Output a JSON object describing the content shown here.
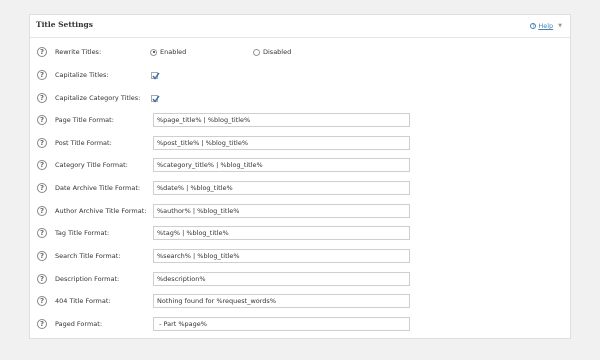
{
  "panel": {
    "title": "Title Settings",
    "help_label": "Help"
  },
  "icons": {
    "help": "question-circle-icon",
    "toggle": "triangle-down-icon",
    "checkmark": "checkmark-icon"
  },
  "rewrite_titles": {
    "label": "Rewrite Titles:",
    "options": [
      "Enabled",
      "Disabled"
    ],
    "selected": "Enabled"
  },
  "capitalize_titles": {
    "label": "Capitalize Titles:",
    "checked": true
  },
  "capitalize_category_titles": {
    "label": "Capitalize Category Titles:",
    "checked": true
  },
  "fields": [
    {
      "label": "Page Title Format:",
      "value": "%page_title% | %blog_title%"
    },
    {
      "label": "Post Title Format:",
      "value": "%post_title% | %blog_title%"
    },
    {
      "label": "Category Title Format:",
      "value": "%category_title% | %blog_title%"
    },
    {
      "label": "Date Archive Title Format:",
      "value": "%date% | %blog_title%"
    },
    {
      "label": "Author Archive Title Format:",
      "value": "%author% | %blog_title%"
    },
    {
      "label": "Tag Title Format:",
      "value": "%tag% | %blog_title%"
    },
    {
      "label": "Search Title Format:",
      "value": "%search% | %blog_title%"
    },
    {
      "label": "Description Format:",
      "value": "%description%"
    },
    {
      "label": "404 Title Format:",
      "value": "Nothing found for %request_words%"
    },
    {
      "label": "Paged Format:",
      "value": " - Part %page%"
    }
  ]
}
